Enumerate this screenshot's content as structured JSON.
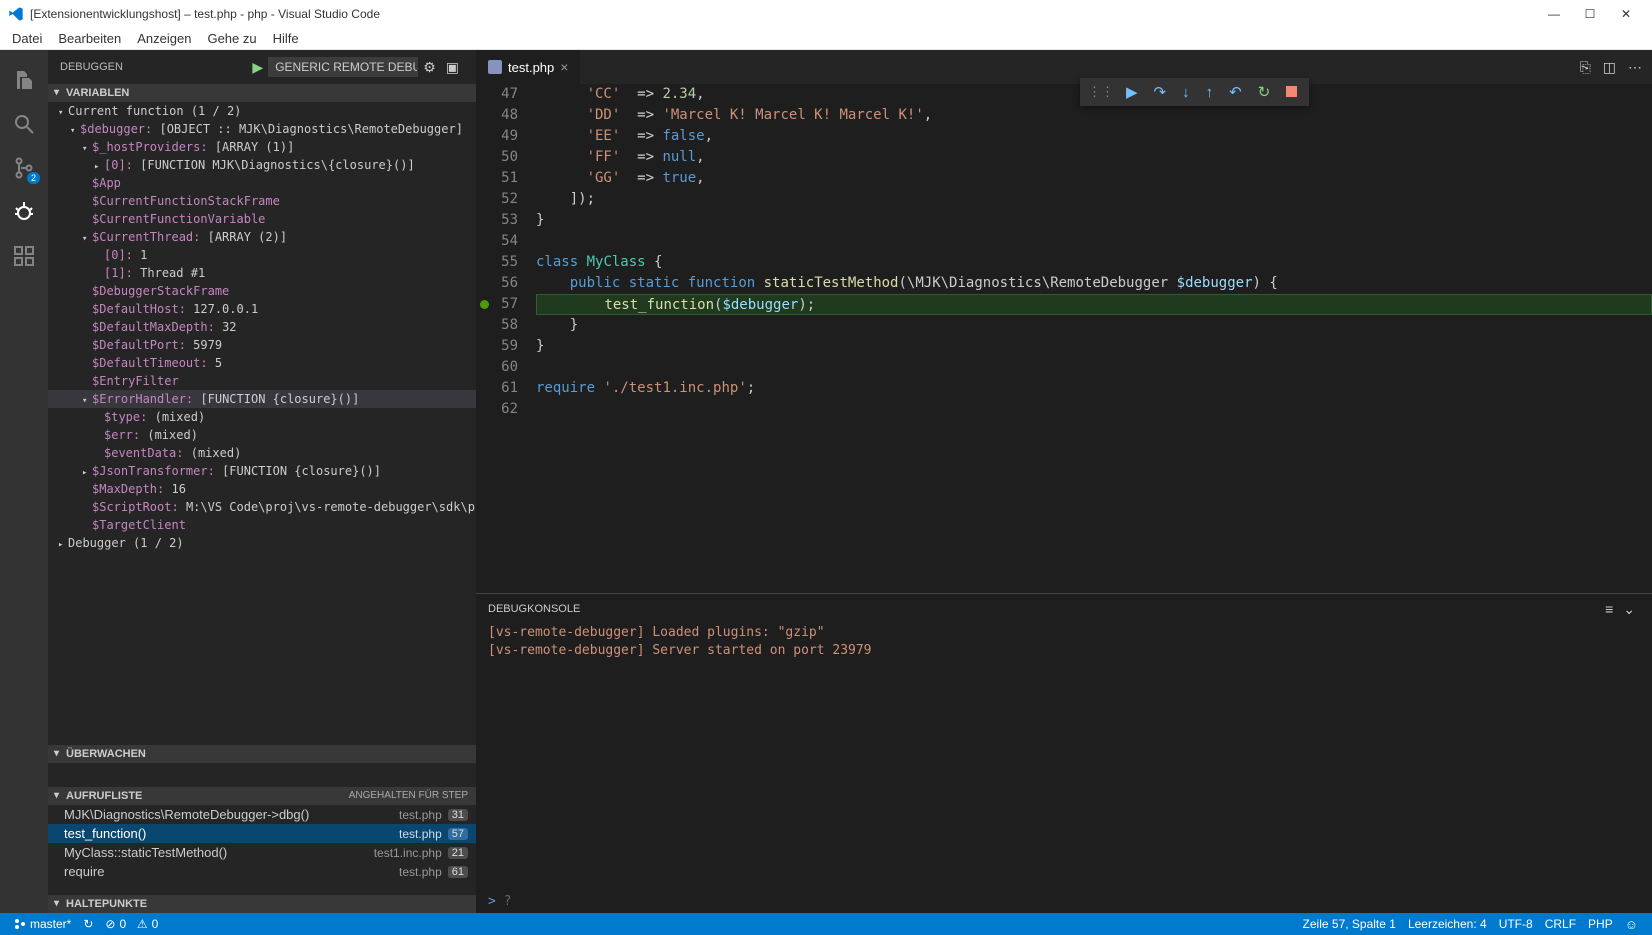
{
  "window": {
    "title": "[Extensionentwicklungshost] – test.php - php - Visual Studio Code"
  },
  "menu": {
    "items": [
      "Datei",
      "Bearbeiten",
      "Anzeigen",
      "Gehe zu",
      "Hilfe"
    ]
  },
  "activitybar": {
    "git_badge": "2"
  },
  "debug": {
    "title": "DEBUGGEN",
    "config": "Generic Remote Debugg",
    "sections": {
      "variables": "VARIABLEN",
      "watch": "ÜBERWACHEN",
      "callstack": "AUFRUFLISTE",
      "callstack_state": "ANGEHALTEN FÜR STEP",
      "breakpoints": "HALTEPUNKTE"
    },
    "scopes": [
      {
        "name": "Current function (1 / 2)"
      },
      {
        "name": "Debugger (1 / 2)"
      }
    ],
    "variables": {
      "debugger": {
        "k": "$debugger:",
        "v": "[OBJECT :: MJK\\Diagnostics\\RemoteDebugger]"
      },
      "hostProviders": {
        "k": "$_hostProviders:",
        "v": "[ARRAY (1)]"
      },
      "hostProviders_0": {
        "k": "[0]:",
        "v": "[FUNCTION MJK\\Diagnostics\\{closure}()]"
      },
      "app": {
        "k": "$App"
      },
      "curFnStack": {
        "k": "$CurrentFunctionStackFrame"
      },
      "curFnVar": {
        "k": "$CurrentFunctionVariable"
      },
      "curThread": {
        "k": "$CurrentThread:",
        "v": "[ARRAY (2)]"
      },
      "ct_0": {
        "k": "[0]:",
        "v": "1"
      },
      "ct_1": {
        "k": "[1]:",
        "v": "Thread #1"
      },
      "dbgStack": {
        "k": "$DebuggerStackFrame"
      },
      "defHost": {
        "k": "$DefaultHost:",
        "v": "127.0.0.1"
      },
      "defMaxDepth": {
        "k": "$DefaultMaxDepth:",
        "v": "32"
      },
      "defPort": {
        "k": "$DefaultPort:",
        "v": "5979"
      },
      "defTimeout": {
        "k": "$DefaultTimeout:",
        "v": "5"
      },
      "entryFilter": {
        "k": "$EntryFilter"
      },
      "errHandler": {
        "k": "$ErrorHandler:",
        "v": "[FUNCTION {closure}()]"
      },
      "eh_type": {
        "k": "$type:",
        "v": "(mixed)"
      },
      "eh_err": {
        "k": "$err:",
        "v": "(mixed)"
      },
      "eh_event": {
        "k": "$eventData:",
        "v": "(mixed)"
      },
      "jsonTrans": {
        "k": "$JsonTransformer:",
        "v": "[FUNCTION {closure}()]"
      },
      "maxDepth": {
        "k": "$MaxDepth:",
        "v": "16"
      },
      "scriptRoot": {
        "k": "$ScriptRoot:",
        "v": "M:\\VS Code\\proj\\vs-remote-debugger\\sdk\\php"
      },
      "targetClient": {
        "k": "$TargetClient"
      }
    },
    "callstack": [
      {
        "name": "MJK\\Diagnostics\\RemoteDebugger->dbg()",
        "file": "test.php",
        "line": "31"
      },
      {
        "name": "test_function()",
        "file": "test.php",
        "line": "57"
      },
      {
        "name": "MyClass::staticTestMethod()",
        "file": "test1.inc.php",
        "line": "21"
      },
      {
        "name": "require",
        "file": "test.php",
        "line": "61"
      }
    ]
  },
  "editor_tab": {
    "label": "test.php"
  },
  "code": {
    "lines": [
      {
        "n": "47",
        "h": "      <span class='tok-str'>'CC'</span>  <span class='tok-op'>=&gt;</span> <span class='tok-num'>2.34</span>,"
      },
      {
        "n": "48",
        "h": "      <span class='tok-str'>'DD'</span>  <span class='tok-op'>=&gt;</span> <span class='tok-str'>'Marcel K! Marcel K! Marcel K!'</span>,"
      },
      {
        "n": "49",
        "h": "      <span class='tok-str'>'EE'</span>  <span class='tok-op'>=&gt;</span> <span class='tok-const'>false</span>,"
      },
      {
        "n": "50",
        "h": "      <span class='tok-str'>'FF'</span>  <span class='tok-op'>=&gt;</span> <span class='tok-const'>null</span>,"
      },
      {
        "n": "51",
        "h": "      <span class='tok-str'>'GG'</span>  <span class='tok-op'>=&gt;</span> <span class='tok-const'>true</span>,"
      },
      {
        "n": "52",
        "h": "    ]);"
      },
      {
        "n": "53",
        "h": "}"
      },
      {
        "n": "54",
        "h": ""
      },
      {
        "n": "55",
        "h": "<span class='tok-kw'>class</span> <span class='tok-cls'>MyClass</span> {"
      },
      {
        "n": "56",
        "h": "    <span class='tok-kw'>public</span> <span class='tok-kw'>static</span> <span class='tok-kw'>function</span> <span class='tok-fn'>staticTestMethod</span>(\\MJK\\Diagnostics\\RemoteDebugger <span class='tok-var'>$debugger</span>) {"
      },
      {
        "n": "57",
        "h": "        <span class='tok-fn'>test_function</span>(<span class='tok-var'>$debugger</span>);",
        "cur": true,
        "bp": true
      },
      {
        "n": "58",
        "h": "    }"
      },
      {
        "n": "59",
        "h": "}"
      },
      {
        "n": "60",
        "h": ""
      },
      {
        "n": "61",
        "h": "<span class='tok-kw'>require</span> <span class='tok-str'>'./test1.inc.php'</span>;"
      },
      {
        "n": "62",
        "h": ""
      }
    ]
  },
  "panel": {
    "title": "DEBUGKONSOLE",
    "lines": [
      "[vs-remote-debugger] Loaded plugins: \"gzip\"",
      "[vs-remote-debugger] Server started on port 23979"
    ],
    "prompt": ">"
  },
  "status": {
    "branch": "master*",
    "errors": "0",
    "warnings": "0",
    "cursor": "Zeile 57, Spalte 1",
    "spaces": "Leerzeichen: 4",
    "encoding": "UTF-8",
    "eol": "CRLF",
    "lang": "PHP"
  }
}
